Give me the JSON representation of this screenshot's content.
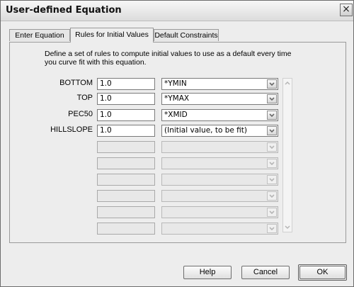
{
  "window": {
    "title": "User-defined Equation"
  },
  "tabs": [
    {
      "label": "Enter Equation"
    },
    {
      "label": "Rules for Initial Values"
    },
    {
      "label": "Default Constraints"
    }
  ],
  "description": "Define a set of rules to compute initial values to use as a default every time you curve fit with this equation.",
  "rows": [
    {
      "label": "BOTTOM",
      "value": "1.0",
      "rule": "*YMIN"
    },
    {
      "label": "TOP",
      "value": "1.0",
      "rule": "*YMAX"
    },
    {
      "label": "PEC50",
      "value": "1.0",
      "rule": "*XMID"
    },
    {
      "label": "HILLSLOPE",
      "value": "1.0",
      "rule": "(Initial value, to be fit)"
    }
  ],
  "empty_rows": 6,
  "buttons": {
    "help": "Help",
    "cancel": "Cancel",
    "ok": "OK"
  },
  "icons": {
    "close": "close-icon",
    "dropdown": "chevron-down-icon",
    "scroll_up": "scroll-up-icon",
    "scroll_down": "scroll-down-icon"
  }
}
